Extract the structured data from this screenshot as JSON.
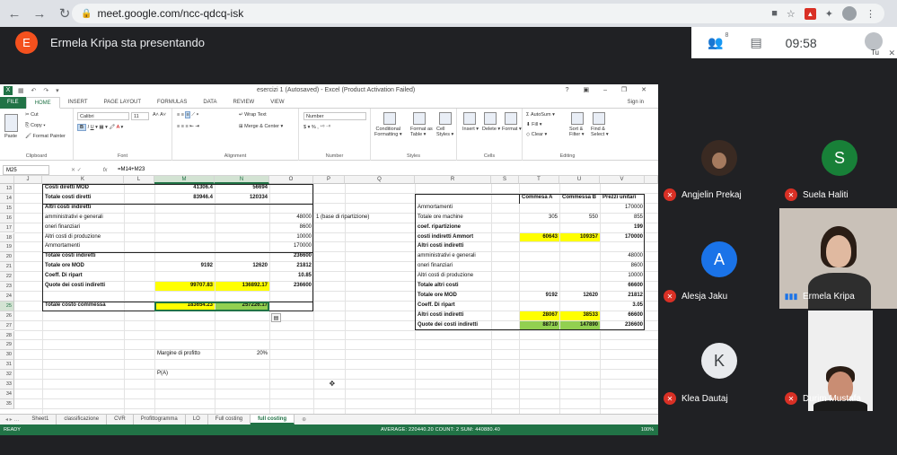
{
  "browser": {
    "url": "meet.google.com/ncc-qdcq-isk"
  },
  "meet": {
    "presenter_initial": "E",
    "presenter_text": "Ermela Kripa sta presentando",
    "participants_count": "8",
    "time": "09:58",
    "you_label": "Tu",
    "participants": [
      {
        "name": "Angjelin Prekaj",
        "type": "photo"
      },
      {
        "name": "Suela Haliti",
        "initial": "S",
        "color": "#188038"
      },
      {
        "name": "Alesja Jaku",
        "initial": "A",
        "color": "#1a73e8"
      },
      {
        "name": "Ermela Kripa",
        "type": "video"
      },
      {
        "name": "Klea Dautaj",
        "initial": "K",
        "color": "#e8eaed"
      },
      {
        "name": "Durim Mustafa",
        "type": "video"
      }
    ]
  },
  "excel": {
    "window_title": "esercizi 1 (Autosaved) - Excel (Product Activation Failed)",
    "window_controls": "? ▣ – ❐ ✕",
    "tabs": [
      "FILE",
      "HOME",
      "INSERT",
      "PAGE LAYOUT",
      "FORMULAS",
      "DATA",
      "REVIEW",
      "VIEW"
    ],
    "sign_in": "Sign in",
    "ribbon": {
      "cut": "Cut",
      "copy": "Copy",
      "format_painter": "Format Painter",
      "paste": "Paste",
      "clipboard": "Clipboard",
      "font_name": "Calibri",
      "font_size": "11",
      "font": "Font",
      "wrap_text": "Wrap Text",
      "merge_center": "Merge & Center",
      "alignment": "Alignment",
      "number_format": "Number",
      "number": "Number",
      "conditional": "Conditional Formatting",
      "format_as_table": "Format as Table",
      "cell_styles": "Cell Styles",
      "styles": "Styles",
      "insert": "Insert",
      "delete": "Delete",
      "format": "Format",
      "cells": "Cells",
      "autosum": "AutoSum",
      "fill": "Fill",
      "clear": "Clear",
      "sort_filter": "Sort & Filter",
      "find_select": "Find & Select",
      "editing": "Editing",
      "fmt_cond_l1": "Conditional",
      "fmt_cond_l2": "Formatting ▾",
      "fmt_table_l1": "Format as",
      "fmt_table_l2": "Table ▾",
      "cell_styles_l1": "Cell",
      "cell_styles_l2": "Styles ▾",
      "sort_l1": "Sort &",
      "sort_l2": "Filter ▾",
      "find_l1": "Find &",
      "find_l2": "Select ▾"
    },
    "name_box": "M25",
    "formula": "=M14+M23",
    "columns": [
      "J",
      "K",
      "L",
      "M",
      "N",
      "O",
      "P",
      "Q",
      "R",
      "S",
      "T",
      "U",
      "V"
    ],
    "rows": [
      "13",
      "14",
      "15",
      "16",
      "17",
      "18",
      "19",
      "20",
      "21",
      "22",
      "23",
      "24",
      "25",
      "26",
      "27",
      "28",
      "29",
      "30",
      "31",
      "32",
      "33",
      "34",
      "35"
    ],
    "left_table": {
      "r13": {
        "label": "Costi diretti MOD",
        "m": "41306.4",
        "n": "56694"
      },
      "r14": {
        "label": "Totale costi diretti",
        "m": "83946.4",
        "n": "120334"
      },
      "r15": {
        "label": "Altri costi indiretti"
      },
      "r16": {
        "label": "amministrativi e generali",
        "o": "48000",
        "p": "1 (base di ripartizione)"
      },
      "r17": {
        "label": "oneri finanziari",
        "o": "8600"
      },
      "r18": {
        "label": "Altri costi di produzione",
        "o": "10000"
      },
      "r19": {
        "label": "Ammortamenti",
        "o": "170000"
      },
      "r20": {
        "label": "Totale costi indiretti",
        "o": "236600"
      },
      "r21": {
        "label": "Totale ore MOD",
        "m": "9192",
        "n": "12620",
        "o": "21812"
      },
      "r22": {
        "label": "Coeff. Di ripart",
        "o": "10.85"
      },
      "r23": {
        "label": "Quote dei costi indiretti",
        "m": "99707.83",
        "n": "136892.17",
        "o": "236600"
      },
      "r25": {
        "label": "Totale costo commessa",
        "m": "183654.23",
        "n": "257226.17"
      },
      "r30": {
        "label": "Margine di profitto",
        "n": "20%"
      },
      "r32": {
        "label": "P(A)"
      }
    },
    "right_table": {
      "headers": {
        "t": "Commesa A",
        "u": "Commessa B",
        "v": "Prezzi unitari"
      },
      "r15": {
        "label": "Ammortamenti",
        "v": "170000"
      },
      "r16": {
        "label": "Totale ore machine",
        "t": "305",
        "u": "550",
        "v": "855"
      },
      "r17": {
        "label": "coef. ripartizione",
        "v": "199"
      },
      "r18": {
        "label": "costi indiretti Ammort",
        "t": "60643",
        "u": "109357",
        "v": "170000"
      },
      "r19": {
        "label": "Altri costi indiretti"
      },
      "r20": {
        "label": "amministrativi e generali",
        "v": "48000"
      },
      "r21": {
        "label": "oneri finanziari",
        "v": "8600"
      },
      "r22": {
        "label": "Altri costi di produzione",
        "v": "10000"
      },
      "r23": {
        "label": "Totale altri costi",
        "v": "66600"
      },
      "r24": {
        "label": "Totale ore MOD",
        "t": "9192",
        "u": "12620",
        "v": "21812"
      },
      "r25": {
        "label": "Coeff. Di ripart",
        "v": "3.05"
      },
      "r26": {
        "label": "Altri costi indiretti",
        "t": "28067",
        "u": "38533",
        "v": "66600"
      },
      "r27": {
        "label": "Quote dei costi indiretti",
        "t": "88710",
        "u": "147890",
        "v": "236600"
      }
    },
    "sheets": [
      "Sheet1",
      "classificazione",
      "CVR",
      "Profittogramma",
      "LO",
      "Full costing",
      "full costing"
    ],
    "status": {
      "ready": "READY",
      "stats": "AVERAGE: 220440.20     COUNT: 2     SUM: 440880.40",
      "zoom": "100%"
    }
  }
}
